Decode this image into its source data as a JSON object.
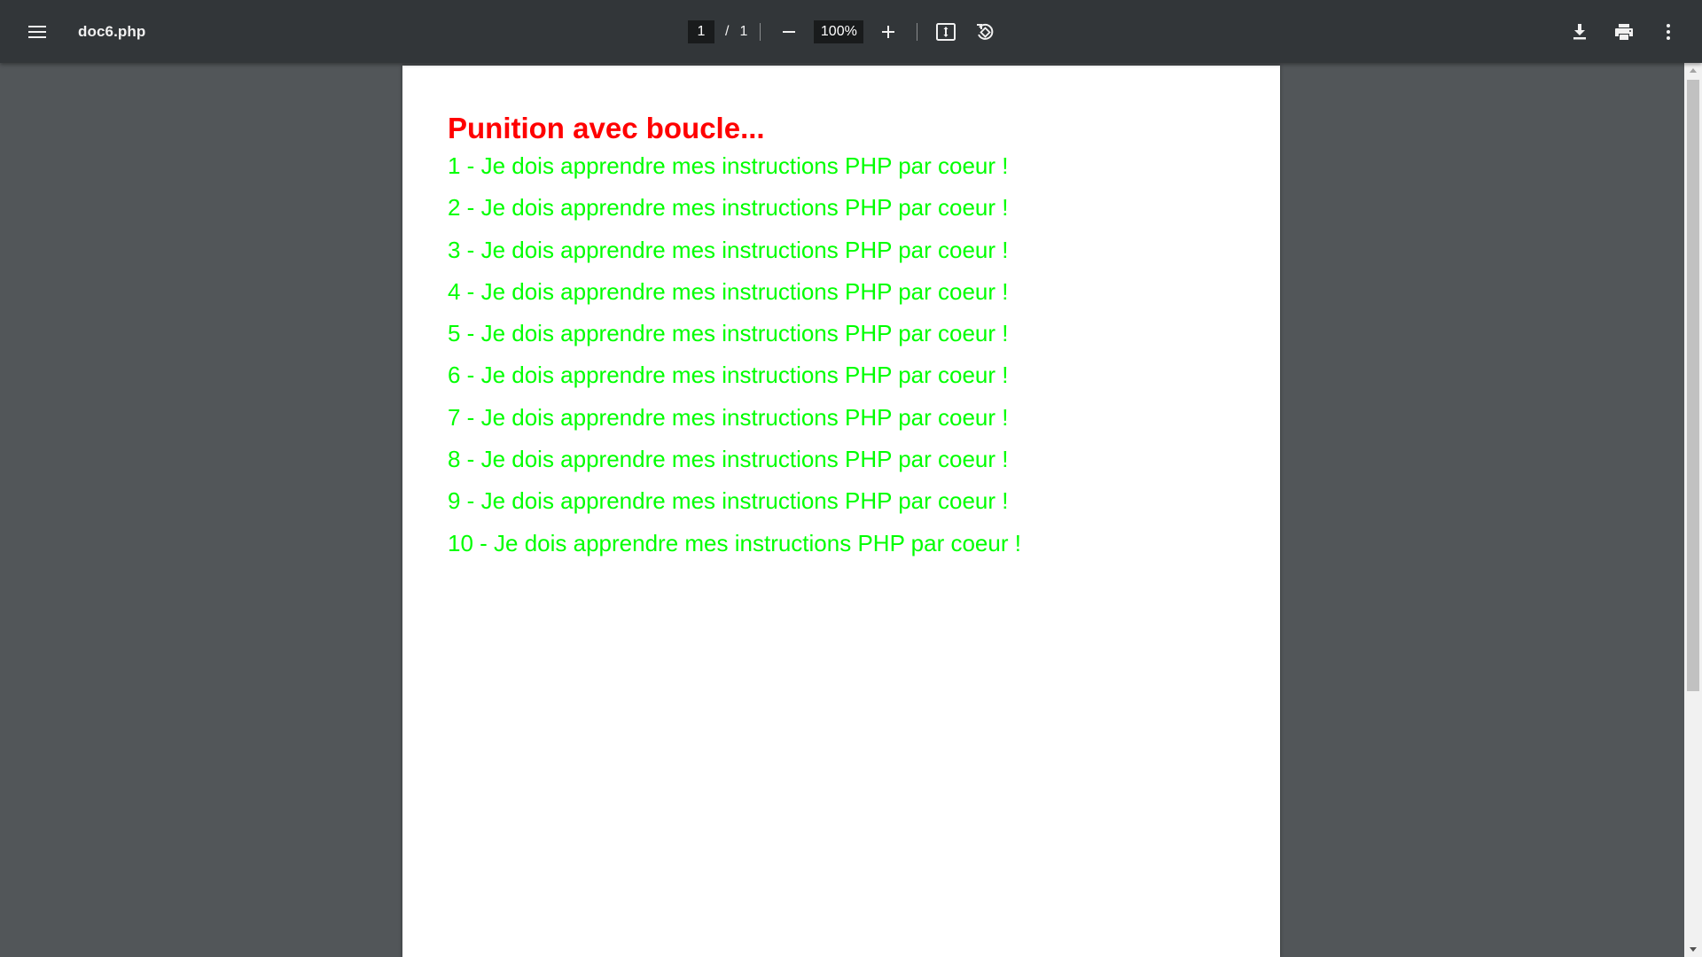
{
  "toolbar": {
    "menu_icon": "menu-icon",
    "title": "doc6.php",
    "current_page": "1",
    "page_separator": "/",
    "total_pages": "1",
    "zoom_out_icon": "minus-icon",
    "zoom_level": "100%",
    "zoom_in_icon": "plus-icon",
    "fit_icon": "fit-to-page-icon",
    "rotate_icon": "rotate-counterclockwise-icon",
    "download_icon": "download-icon",
    "print_icon": "print-icon",
    "more_icon": "more-vertical-icon"
  },
  "document": {
    "heading": "Punition avec boucle...",
    "heading_color": "#ff0000",
    "line_color": "#00ff00",
    "lines": [
      "1 - Je dois apprendre mes instructions PHP par coeur !",
      "2 - Je dois apprendre mes instructions PHP par coeur !",
      "3 - Je dois apprendre mes instructions PHP par coeur !",
      "4 - Je dois apprendre mes instructions PHP par coeur !",
      "5 - Je dois apprendre mes instructions PHP par coeur !",
      "6 - Je dois apprendre mes instructions PHP par coeur !",
      "7 - Je dois apprendre mes instructions PHP par coeur !",
      "8 - Je dois apprendre mes instructions PHP par coeur !",
      "9 - Je dois apprendre mes instructions PHP par coeur !",
      "10 - Je dois apprendre mes instructions PHP par coeur !"
    ]
  },
  "colors": {
    "toolbar_bg": "#323639",
    "viewer_bg": "#525659",
    "page_bg": "#ffffff"
  }
}
